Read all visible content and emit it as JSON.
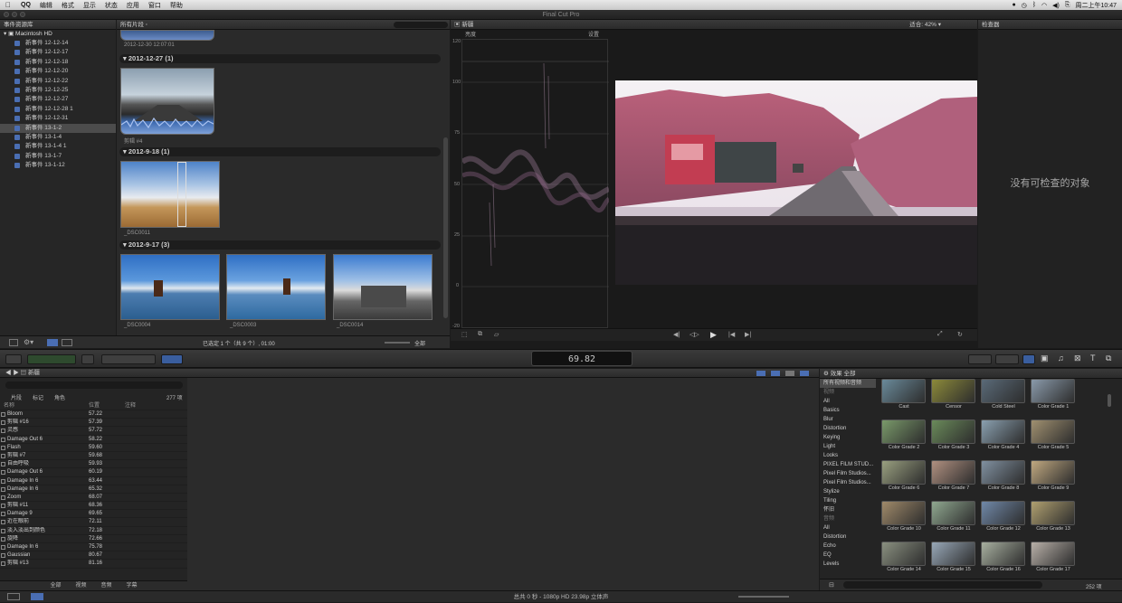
{
  "menubar": {
    "items": [
      "QQ",
      "编辑",
      "格式",
      "显示",
      "状态",
      "应用",
      "窗口",
      "帮助"
    ],
    "clock": "周二上午10:47"
  },
  "window": {
    "title": "Final Cut Pro"
  },
  "library": {
    "header": "事件资源库",
    "root": "Macintosh HD",
    "events": [
      "新事件 12-12-14",
      "新事件 12-12-17",
      "新事件 12-12-18",
      "新事件 12-12-20",
      "新事件 12-12-22",
      "新事件 12-12-25",
      "新事件 12-12-27",
      "新事件 12-12-28 1",
      "新事件 12-12-31",
      "新事件 13-1-2",
      "新事件 13-1-4",
      "新事件 13-1-4 1",
      "新事件 13-1-7",
      "新事件 13-1-12"
    ],
    "selected_index": 9
  },
  "browser": {
    "header": "所有片段",
    "top_caption": "2012-12-30 12:07:01",
    "groups": [
      {
        "date": "2012-12-27",
        "count": "(1)",
        "clips": [
          "剪辑 #4"
        ]
      },
      {
        "date": "2012-9-18",
        "count": "(1)",
        "clips": [
          "_DSC0011"
        ]
      },
      {
        "date": "2012-9-17",
        "count": "(3)",
        "clips": [
          "_DSC0004",
          "_DSC0003",
          "_DSC0014"
        ]
      }
    ],
    "footer_status": "已选定 1 个（共 9 个）, 01:00",
    "footer_filter": "全部"
  },
  "viewer": {
    "header": "新疆",
    "zoom_label": "适合:",
    "zoom_value": "42%",
    "scope_label": "亮度",
    "scope_settings": "设置",
    "scope_ticks": [
      "120",
      "100",
      "75",
      "50",
      "25",
      "0",
      "-20"
    ]
  },
  "inspector": {
    "header": "检查器",
    "empty_message": "没有可检查的对象"
  },
  "toolbar": {
    "timecode": "69.82"
  },
  "timeline": {
    "project_name": "新疆",
    "index_tabs": [
      "片段",
      "标记",
      "角色"
    ],
    "index_count": "277 项",
    "columns": [
      "名称",
      "位置",
      "注释"
    ],
    "rows": [
      {
        "name": "Bloom",
        "pos": "57.22"
      },
      {
        "name": "剪辑 #16",
        "pos": "57.39"
      },
      {
        "name": "灵感",
        "pos": "57.72"
      },
      {
        "name": "Damage Out 6",
        "pos": "58.22"
      },
      {
        "name": "Flash",
        "pos": "59.60"
      },
      {
        "name": "剪辑 #7",
        "pos": "59.68"
      },
      {
        "name": "自由呼吸",
        "pos": "59.93"
      },
      {
        "name": "Damage Out 6",
        "pos": "60.19"
      },
      {
        "name": "Damage In 6",
        "pos": "63.44"
      },
      {
        "name": "Damage In 6",
        "pos": "65.32"
      },
      {
        "name": "Zoom",
        "pos": "68.07"
      },
      {
        "name": "剪辑 #11",
        "pos": "68.36"
      },
      {
        "name": "Damage 9",
        "pos": "69.65"
      },
      {
        "name": "近在眼前",
        "pos": "72.11"
      },
      {
        "name": "淡入淡出到颜色",
        "pos": "72.18"
      },
      {
        "name": "旋降",
        "pos": "72.66"
      },
      {
        "name": "Damage In 6",
        "pos": "75.78"
      },
      {
        "name": "Gaussian",
        "pos": "80.67"
      },
      {
        "name": "剪辑 #13",
        "pos": "81.16"
      }
    ],
    "bottom_tabs": [
      "全部",
      "视频",
      "音频",
      "字幕"
    ]
  },
  "effects": {
    "header": "效果",
    "header_all": "全部",
    "categories": [
      {
        "label": "所有视频和音频",
        "style": "sel"
      },
      {
        "label": "视频",
        "style": "grey"
      },
      {
        "label": "All",
        "style": ""
      },
      {
        "label": "Basics",
        "style": ""
      },
      {
        "label": "Blur",
        "style": ""
      },
      {
        "label": "Distortion",
        "style": ""
      },
      {
        "label": "Keying",
        "style": ""
      },
      {
        "label": "Light",
        "style": ""
      },
      {
        "label": "Looks",
        "style": ""
      },
      {
        "label": "PIXEL FILM STUD...",
        "style": ""
      },
      {
        "label": "Pixel Film Studios...",
        "style": ""
      },
      {
        "label": "Pixel Film Studios...",
        "style": ""
      },
      {
        "label": "Stylize",
        "style": ""
      },
      {
        "label": "Tiling",
        "style": ""
      },
      {
        "label": "怀旧",
        "style": ""
      },
      {
        "label": "音频",
        "style": "grey"
      },
      {
        "label": "All",
        "style": ""
      },
      {
        "label": "Distortion",
        "style": ""
      },
      {
        "label": "Echo",
        "style": ""
      },
      {
        "label": "EQ",
        "style": ""
      },
      {
        "label": "Levels",
        "style": ""
      }
    ],
    "items": [
      "Cast",
      "Censor",
      "Cold Steel",
      "Color Grade 1",
      "Color Grade 2",
      "Color Grade 3",
      "Color Grade 4",
      "Color Grade 5",
      "Color Grade 6",
      "Color Grade 7",
      "Color Grade 8",
      "Color Grade 9",
      "Color Grade 10",
      "Color Grade 11",
      "Color Grade 12",
      "Color Grade 13",
      "Color Grade 14",
      "Color Grade 15",
      "Color Grade 16",
      "Color Grade 17"
    ],
    "count": "252 项"
  },
  "status": {
    "text": "总共 0 秒 - 1080p HD 23.98p 立体声"
  }
}
